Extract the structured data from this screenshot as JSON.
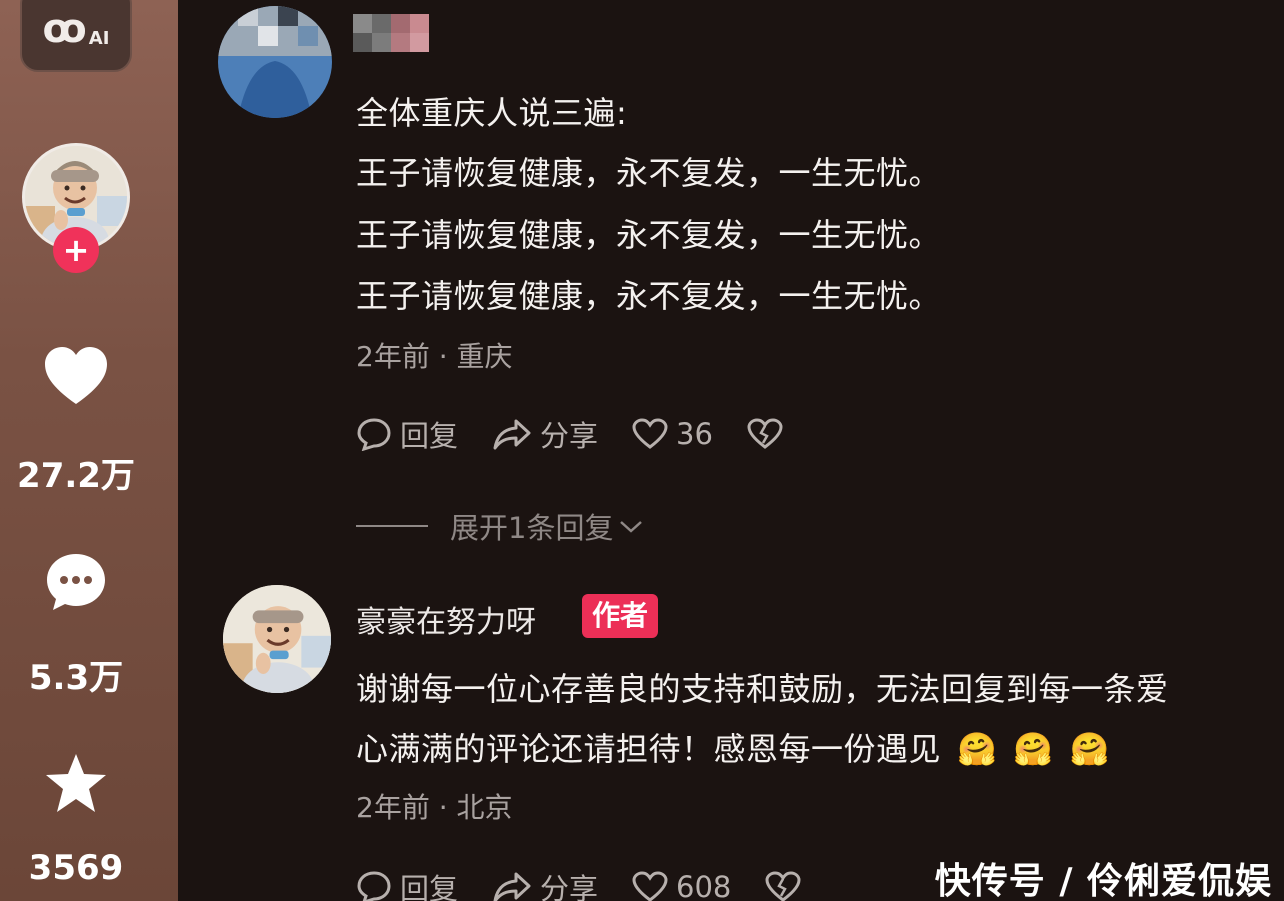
{
  "rail": {
    "ai_badge": "AI",
    "likes": "27.2万",
    "comments": "5.3万",
    "favorites": "3569"
  },
  "comments": [
    {
      "lines": [
        "全体重庆人说三遍:",
        "王子请恢复健康，永不复发，一生无忧。",
        "王子请恢复健康，永不复发，一生无忧。",
        "王子请恢复健康，永不复发，一生无忧。"
      ],
      "meta": "2年前 · 重庆",
      "reply_label": "回复",
      "share_label": "分享",
      "like_count": "36",
      "expand_label": "展开1条回复"
    },
    {
      "author": "豪豪在努力呀",
      "author_tag": "作者",
      "lines": [
        "谢谢每一位心存善良的支持和鼓励，无法回复到每一条爱",
        "心满满的评论还请担待！感恩每一份遇见"
      ],
      "meta": "2年前 · 北京",
      "reply_label": "回复",
      "share_label": "分享",
      "like_count": "608"
    }
  ],
  "watermark": "快传号 / 伶俐爱侃娱",
  "colors": {
    "accent": "#ec2f57",
    "background": "#1b1311",
    "rail": "#7a5244"
  }
}
